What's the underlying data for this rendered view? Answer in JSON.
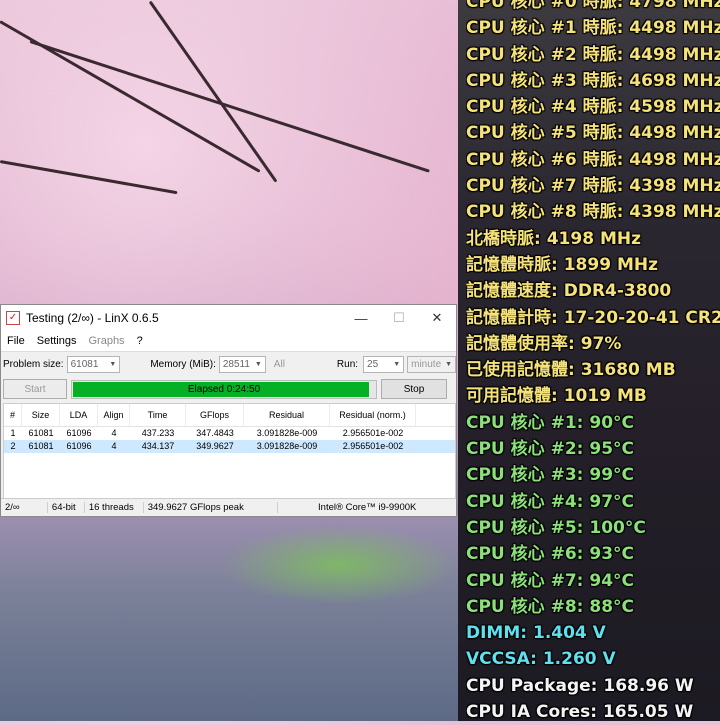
{
  "overlay": {
    "lines": [
      {
        "text": "CPU 核心 #0 時脈: 4798 MHz",
        "color": "yellow"
      },
      {
        "text": "CPU 核心 #1 時脈: 4498 MHz",
        "color": "yellow"
      },
      {
        "text": "CPU 核心 #2 時脈: 4498 MHz",
        "color": "yellow"
      },
      {
        "text": "CPU 核心 #3 時脈: 4698 MHz",
        "color": "yellow"
      },
      {
        "text": "CPU 核心 #4 時脈: 4598 MHz",
        "color": "yellow"
      },
      {
        "text": "CPU 核心 #5 時脈: 4498 MHz",
        "color": "yellow"
      },
      {
        "text": "CPU 核心 #6 時脈: 4498 MHz",
        "color": "yellow"
      },
      {
        "text": "CPU 核心 #7 時脈: 4398 MHz",
        "color": "yellow"
      },
      {
        "text": "CPU 核心 #8 時脈: 4398 MHz",
        "color": "yellow"
      },
      {
        "text": "北橋時脈: 4198 MHz",
        "color": "yellow"
      },
      {
        "text": "記憶體時脈: 1899 MHz",
        "color": "yellow"
      },
      {
        "text": "記憶體速度: DDR4-3800",
        "color": "yellow"
      },
      {
        "text": "記憶體計時: 17-20-20-41 CR2",
        "color": "yellow"
      },
      {
        "text": "記憶體使用率: 97%",
        "color": "yellow"
      },
      {
        "text": "已使用記憶體: 31680 MB",
        "color": "yellow"
      },
      {
        "text": "可用記憶體: 1019 MB",
        "color": "yellow"
      },
      {
        "text": "CPU 核心 #1: 90°C",
        "color": "green"
      },
      {
        "text": "CPU 核心 #2: 95°C",
        "color": "green"
      },
      {
        "text": "CPU 核心 #3: 99°C",
        "color": "green"
      },
      {
        "text": "CPU 核心 #4: 97°C",
        "color": "green"
      },
      {
        "text": "CPU 核心 #5: 100°C",
        "color": "green"
      },
      {
        "text": "CPU 核心 #6: 93°C",
        "color": "green"
      },
      {
        "text": "CPU 核心 #7: 94°C",
        "color": "green"
      },
      {
        "text": "CPU 核心 #8: 88°C",
        "color": "green"
      },
      {
        "text": "DIMM: 1.404 V",
        "color": "cyan"
      },
      {
        "text": "VCCSA: 1.260 V",
        "color": "cyan"
      },
      {
        "text": "CPU Package: 168.96 W",
        "color": "white"
      },
      {
        "text": "CPU IA Cores: 165.05 W",
        "color": "white"
      }
    ]
  },
  "window": {
    "title": "Testing (2/∞) - LinX 0.6.5",
    "app_icon": "linx-check-icon",
    "controls": {
      "minimize": "—",
      "maximize": "☐",
      "close": "✕"
    },
    "menu": [
      "File",
      "Settings",
      "Graphs",
      "?"
    ],
    "params": {
      "problem_size_label": "Problem size:",
      "problem_size_value": "61081",
      "memory_label": "Memory (MiB):",
      "memory_value": "28511",
      "all_label": "All",
      "run_label": "Run:",
      "run_value": "25",
      "run_unit": "minute"
    },
    "actions": {
      "start_label": "Start",
      "progress_text": "Elapsed 0:24:50",
      "progress_fraction": 0.98,
      "stop_label": "Stop"
    },
    "table": {
      "columns": [
        "#",
        "Size",
        "LDA",
        "Align",
        "Time",
        "GFlops",
        "Residual",
        "Residual (norm.)"
      ],
      "rows": [
        [
          "1",
          "61081",
          "61096",
          "4",
          "437.233",
          "347.4843",
          "3.091828e-009",
          "2.956501e-002"
        ],
        [
          "2",
          "61081",
          "61096",
          "4",
          "434.137",
          "349.9627",
          "3.091828e-009",
          "2.956501e-002"
        ]
      ],
      "selected_row": 1
    },
    "status": {
      "runs": "2/∞",
      "bits": "64-bit",
      "threads": "16 threads",
      "peak": "349.9627 GFlops peak",
      "cpu": "Intel® Core™ i9-9900K"
    }
  },
  "colors": {
    "yellow": "#f5e27a",
    "green": "#8be07a",
    "cyan": "#5fe0f0",
    "white": "#f4f4f4",
    "progress": "#06b025",
    "selection": "#cde8ff"
  }
}
